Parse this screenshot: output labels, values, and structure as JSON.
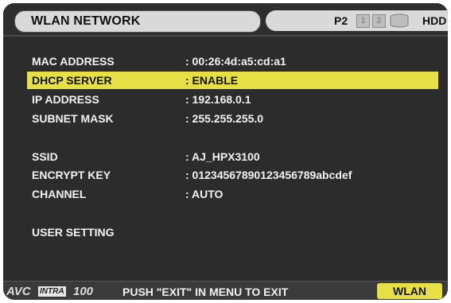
{
  "header": {
    "title": "WLAN NETWORK",
    "media_label": "P2",
    "slot_1": "1",
    "slot_2": "2",
    "drive_icon": "drive-cylinder-icon",
    "hdd_label": "HDD"
  },
  "settings": [
    {
      "label": "MAC ADDRESS",
      "value": ": 00:26:4d:a5:cd:a1"
    },
    {
      "label": "DHCP SERVER",
      "value": ": ENABLE",
      "selected": true
    },
    {
      "label": "IP ADDRESS",
      "value": ": 192.168.0.1"
    },
    {
      "label": "SUBNET MASK",
      "value": ": 255.255.255.0"
    },
    {
      "label": "SSID",
      "value": ": AJ_HPX3100"
    },
    {
      "label": "ENCRYPT KEY",
      "value": ": 0123456789012345678 9abcdef"
    },
    {
      "label": "CHANNEL",
      "value": ": AUTO"
    },
    {
      "label": "USER SETTING",
      "value": ""
    }
  ],
  "footer": {
    "codec_avc": "AVC",
    "codec_intra": "INTRA",
    "codec_rate": "100",
    "message": "PUSH \"EXIT\" IN MENU TO EXIT",
    "mode_button": "WLAN"
  },
  "colors": {
    "highlight": "#e6df45",
    "background": "#2c2c2c",
    "text": "#f2f2f2"
  }
}
